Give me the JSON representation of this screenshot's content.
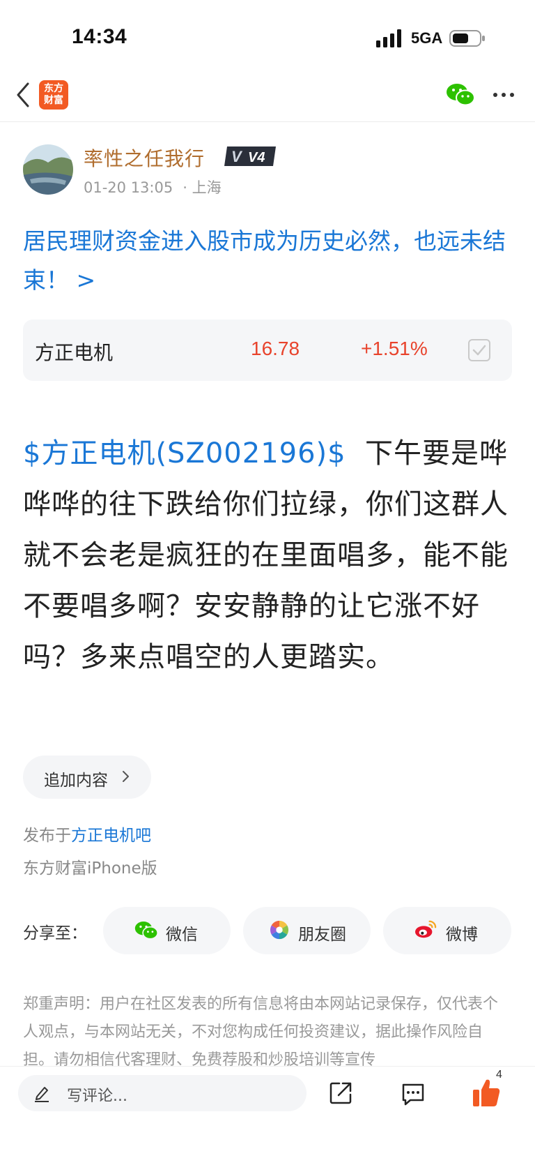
{
  "status_bar": {
    "time": "14:34",
    "network": "5GA"
  },
  "nav": {
    "logo_text_line1": "东方",
    "logo_text_line2": "财富"
  },
  "author": {
    "name": "率性之任我行",
    "level": "V4",
    "date": "01-20 13:05",
    "location": "· 上海"
  },
  "headline": "居民理财资金进入股市成为历史必然，也远未结束！ >",
  "stock": {
    "name": "方正电机",
    "price": "16.78",
    "change": "+1.51%",
    "change_color": "#e8432c"
  },
  "post": {
    "mention": "$方正电机(SZ002196)$",
    "text": "  下午要是哗哗哗的往下跌给你们拉绿，你们这群人就不会老是疯狂的在里面唱多，能不能不要唱多啊？安安静静的让它涨不好吗？多来点唱空的人更踏实。"
  },
  "append_button": "追加内容",
  "published": {
    "prefix": "发布于",
    "bar": "方正电机吧",
    "device": "东方财富iPhone版"
  },
  "share": {
    "label": "分享至：",
    "wechat": "微信",
    "moments": "朋友圈",
    "weibo": "微博"
  },
  "disclaimer": "郑重声明：用户在社区发表的所有信息将由本网站记录保存，仅代表个人观点，与本网站无关，不对您构成任何投资建议，据此操作风险自担。请勿相信代客理财、免费荐股和炒股培训等宣传",
  "bottom": {
    "comment_placeholder": "写评论...",
    "like_count": "4"
  },
  "colors": {
    "link": "#1a77d6",
    "accent": "#f25a23",
    "rise": "#e8432c"
  }
}
